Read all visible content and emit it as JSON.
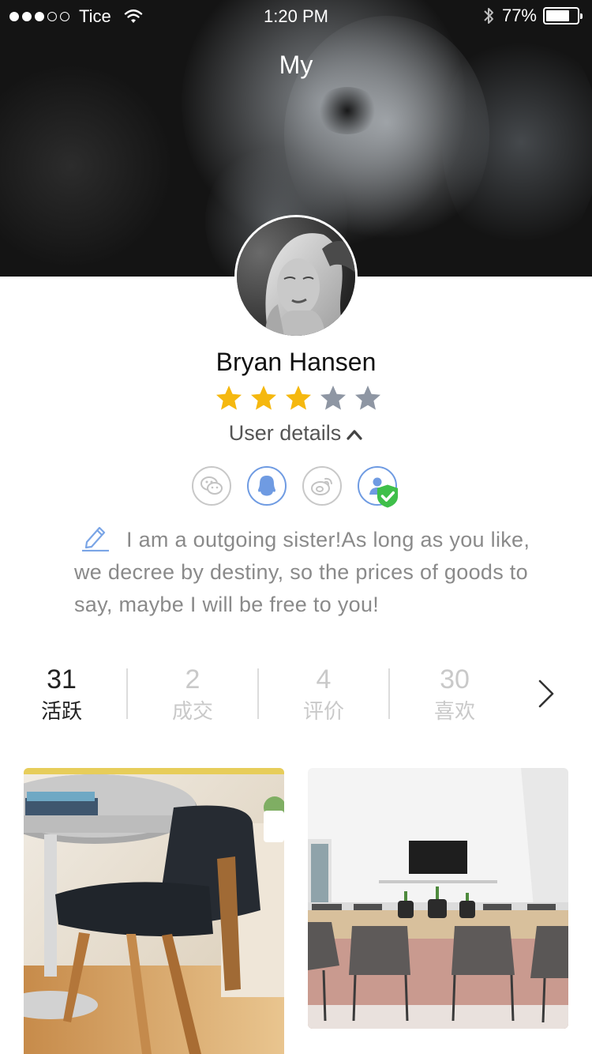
{
  "status_bar": {
    "carrier": "Tice",
    "time": "1:20 PM",
    "battery_percent": "77%",
    "battery_level": 0.77,
    "signal_bars_filled": 3,
    "signal_bars_total": 5
  },
  "header": {
    "title": "My"
  },
  "profile": {
    "name": "Bryan Hansen",
    "rating": 3,
    "rating_max": 5,
    "details_label": "User details",
    "bio": "I am a outgoing sister!As long as you like, we decree by destiny, so the prices of goods to say, maybe I will be free to you!"
  },
  "socials": [
    {
      "icon": "wechat-icon",
      "active": false
    },
    {
      "icon": "qq-icon",
      "active": true
    },
    {
      "icon": "weibo-icon",
      "active": false
    },
    {
      "icon": "verified-user-icon",
      "active": true
    }
  ],
  "stats": [
    {
      "value": "31",
      "label": "活跃"
    },
    {
      "value": "2",
      "label": "成交"
    },
    {
      "value": "4",
      "label": "评价"
    },
    {
      "value": "30",
      "label": "喜欢"
    }
  ],
  "colors": {
    "star_active": "#f5b80f",
    "star_inactive": "#8e96a3",
    "accent_blue": "#6f9be2",
    "verify_green": "#3fbf4a"
  }
}
